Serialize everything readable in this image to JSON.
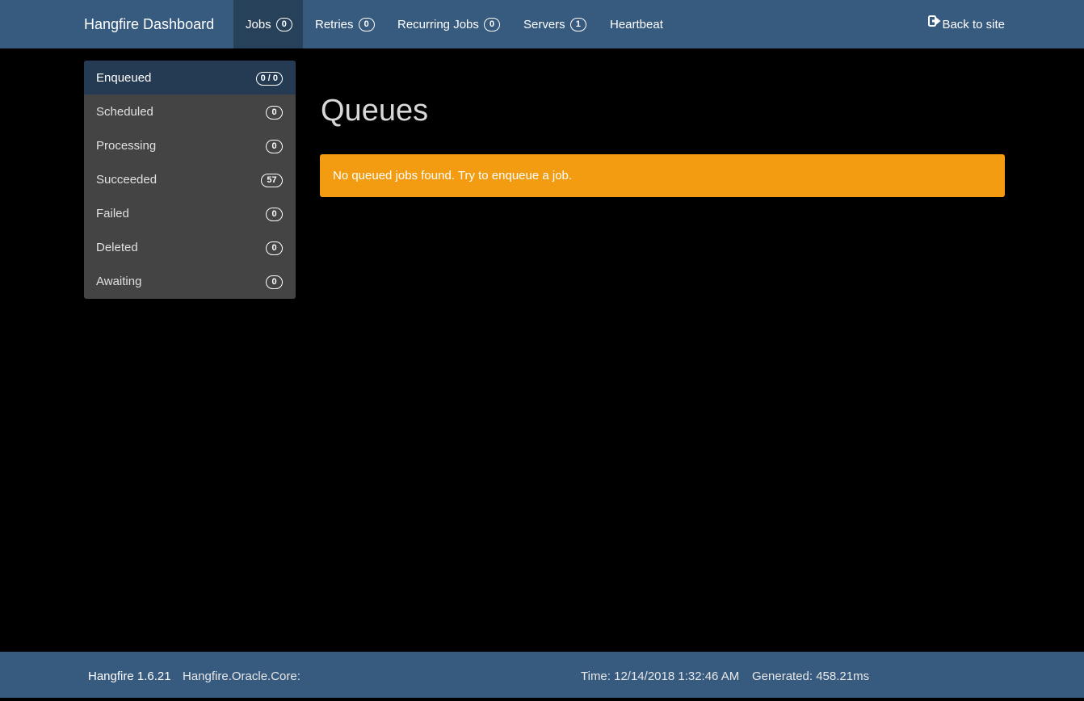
{
  "navbar": {
    "brand": "Hangfire Dashboard",
    "items": [
      {
        "label": "Jobs",
        "badge": "0",
        "active": true
      },
      {
        "label": "Retries",
        "badge": "0"
      },
      {
        "label": "Recurring Jobs",
        "badge": "0"
      },
      {
        "label": "Servers",
        "badge": "1"
      },
      {
        "label": "Heartbeat"
      }
    ],
    "back_label": "Back to site",
    "back_icon": "sign-out-icon"
  },
  "sidebar": {
    "items": [
      {
        "label": "Enqueued",
        "badge": "0 / 0",
        "active": true
      },
      {
        "label": "Scheduled",
        "badge": "0"
      },
      {
        "label": "Processing",
        "badge": "0"
      },
      {
        "label": "Succeeded",
        "badge": "57"
      },
      {
        "label": "Failed",
        "badge": "0"
      },
      {
        "label": "Deleted",
        "badge": "0"
      },
      {
        "label": "Awaiting",
        "badge": "0"
      }
    ]
  },
  "main": {
    "title": "Queues",
    "alert": "No queued jobs found. Try to enqueue a job."
  },
  "footer": {
    "version": "Hangfire 1.6.21",
    "storage": "Hangfire.Oracle.Core:",
    "time": "Time: 12/14/2018 1:32:46 AM",
    "generated": "Generated: 458.21ms"
  },
  "colors": {
    "navbar": "#375a7f",
    "navbar_active": "#28415b",
    "sidebar": "#444444",
    "sidebar_active": "#253b53",
    "alert": "#f39c12",
    "background": "#000000"
  }
}
